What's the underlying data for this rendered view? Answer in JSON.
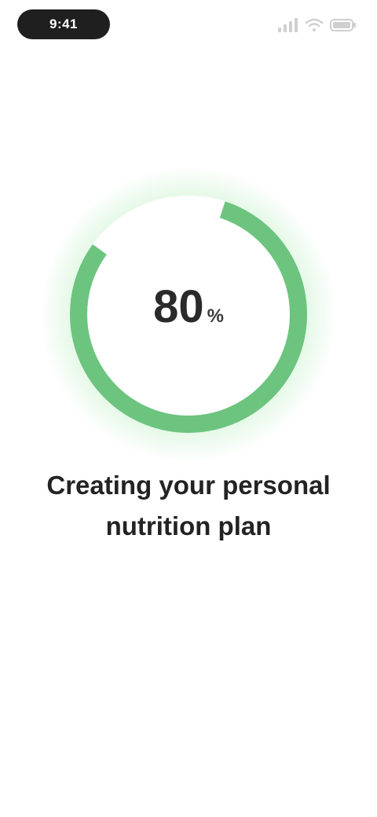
{
  "status_bar": {
    "time": "9:41",
    "signal_icon": "signal-icon",
    "wifi_icon": "wifi-icon",
    "battery_icon": "battery-icon"
  },
  "progress": {
    "value": "80",
    "unit": "%",
    "caption": "",
    "percent": 80,
    "color": "#6cc47f",
    "track_color": "#ffffff"
  },
  "headline": "Creating your personal nutrition plan"
}
